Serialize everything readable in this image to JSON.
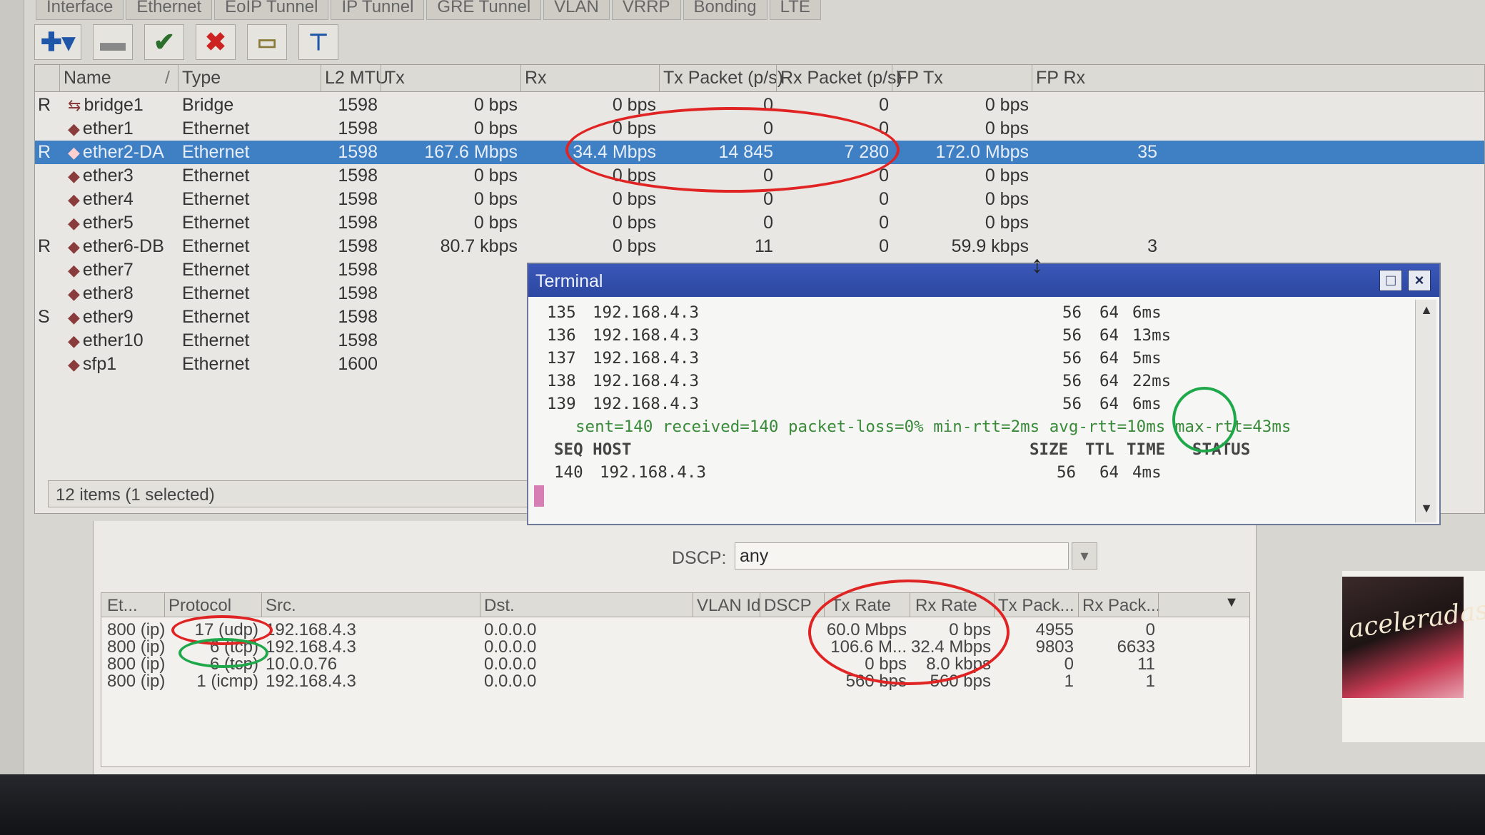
{
  "tabs": [
    "Interface",
    "Ethernet",
    "EoIP Tunnel",
    "IP Tunnel",
    "GRE Tunnel",
    "VLAN",
    "VRRP",
    "Bonding",
    "LTE"
  ],
  "toolbar": {
    "add": "✚▾",
    "remove": "▬",
    "enable": "✔",
    "disable": "✖",
    "comment": "▭",
    "filter": "⊤"
  },
  "interfaces": {
    "columns": [
      "Name",
      "Type",
      "L2 MTU",
      "Tx",
      "Rx",
      "Tx Packet (p/s)",
      "Rx Packet (p/s)",
      "FP Tx",
      "FP Rx"
    ],
    "rows": [
      {
        "flag": "R",
        "icon": "⇆",
        "name": "bridge1",
        "type": "Bridge",
        "mtu": "1598",
        "tx": "0 bps",
        "rx": "0 bps",
        "txp": "0",
        "rxp": "0",
        "fptx": "0 bps",
        "fprx": ""
      },
      {
        "flag": "",
        "icon": "◆",
        "name": "ether1",
        "type": "Ethernet",
        "mtu": "1598",
        "tx": "0 bps",
        "rx": "0 bps",
        "txp": "0",
        "rxp": "0",
        "fptx": "0 bps",
        "fprx": ""
      },
      {
        "flag": "R",
        "icon": "◆",
        "name": "ether2-DA",
        "type": "Ethernet",
        "mtu": "1598",
        "tx": "167.6 Mbps",
        "rx": "34.4 Mbps",
        "txp": "14 845",
        "rxp": "7 280",
        "fptx": "172.0 Mbps",
        "fprx": "35"
      },
      {
        "flag": "",
        "icon": "◆",
        "name": "ether3",
        "type": "Ethernet",
        "mtu": "1598",
        "tx": "0 bps",
        "rx": "0 bps",
        "txp": "0",
        "rxp": "0",
        "fptx": "0 bps",
        "fprx": ""
      },
      {
        "flag": "",
        "icon": "◆",
        "name": "ether4",
        "type": "Ethernet",
        "mtu": "1598",
        "tx": "0 bps",
        "rx": "0 bps",
        "txp": "0",
        "rxp": "0",
        "fptx": "0 bps",
        "fprx": ""
      },
      {
        "flag": "",
        "icon": "◆",
        "name": "ether5",
        "type": "Ethernet",
        "mtu": "1598",
        "tx": "0 bps",
        "rx": "0 bps",
        "txp": "0",
        "rxp": "0",
        "fptx": "0 bps",
        "fprx": ""
      },
      {
        "flag": "R",
        "icon": "◆",
        "name": "ether6-DB",
        "type": "Ethernet",
        "mtu": "1598",
        "tx": "80.7 kbps",
        "rx": "0 bps",
        "txp": "11",
        "rxp": "0",
        "fptx": "59.9 kbps",
        "fprx": "3"
      },
      {
        "flag": "",
        "icon": "◆",
        "name": "ether7",
        "type": "Ethernet",
        "mtu": "1598",
        "tx": "",
        "rx": "",
        "txp": "",
        "rxp": "",
        "fptx": "",
        "fprx": ""
      },
      {
        "flag": "",
        "icon": "◆",
        "name": "ether8",
        "type": "Ethernet",
        "mtu": "1598",
        "tx": "",
        "rx": "",
        "txp": "",
        "rxp": "",
        "fptx": "",
        "fprx": ""
      },
      {
        "flag": "S",
        "icon": "◆",
        "name": "ether9",
        "type": "Ethernet",
        "mtu": "1598",
        "tx": "",
        "rx": "",
        "txp": "",
        "rxp": "",
        "fptx": "",
        "fprx": ""
      },
      {
        "flag": "",
        "icon": "◆",
        "name": "ether10",
        "type": "Ethernet",
        "mtu": "1598",
        "tx": "",
        "rx": "",
        "txp": "",
        "rxp": "",
        "fptx": "",
        "fprx": ""
      },
      {
        "flag": "",
        "icon": "◆",
        "name": "sfp1",
        "type": "Ethernet",
        "mtu": "1600",
        "tx": "",
        "rx": "",
        "txp": "",
        "rxp": "",
        "fptx": "",
        "fprx": ""
      }
    ],
    "footer": "12 items (1 selected)"
  },
  "terminal": {
    "title": "Terminal",
    "lines": [
      {
        "seq": "135",
        "host": "192.168.4.3",
        "size": "56",
        "ttl": "64",
        "time": "6ms"
      },
      {
        "seq": "136",
        "host": "192.168.4.3",
        "size": "56",
        "ttl": "64",
        "time": "13ms"
      },
      {
        "seq": "137",
        "host": "192.168.4.3",
        "size": "56",
        "ttl": "64",
        "time": "5ms"
      },
      {
        "seq": "138",
        "host": "192.168.4.3",
        "size": "56",
        "ttl": "64",
        "time": "22ms"
      },
      {
        "seq": "139",
        "host": "192.168.4.3",
        "size": "56",
        "ttl": "64",
        "time": "6ms"
      }
    ],
    "summary": "sent=140 received=140 packet-loss=0% min-rtt=2ms avg-rtt=10ms max-rtt=43ms",
    "header": {
      "seq": "SEQ HOST",
      "size": "SIZE",
      "ttl": "TTL",
      "time": "TIME",
      "status": "STATUS"
    },
    "last": {
      "seq": "140",
      "host": "192.168.4.3",
      "size": "56",
      "ttl": "64",
      "time": "4ms"
    }
  },
  "filter": {
    "dscp_label": "DSCP:",
    "dscp_value": "any"
  },
  "flows": {
    "columns": [
      "Et...",
      "Protocol",
      "Src.",
      "Dst.",
      "VLAN Id",
      "DSCP",
      "Tx Rate",
      "Rx Rate",
      "Tx Pack...",
      "Rx Pack..."
    ],
    "rows": [
      {
        "et": "800 (ip)",
        "proto": "17 (udp)",
        "src": "192.168.4.3",
        "dst": "0.0.0.0",
        "txrate": "60.0 Mbps",
        "rxrate": "0 bps",
        "txp": "4955",
        "rxp": "0"
      },
      {
        "et": "800 (ip)",
        "proto": "6 (tcp)",
        "src": "192.168.4.3",
        "dst": "0.0.0.0",
        "txrate": "106.6 M...",
        "rxrate": "32.4 Mbps",
        "txp": "9803",
        "rxp": "6633"
      },
      {
        "et": "800 (ip)",
        "proto": "6 (tcp)",
        "src": "10.0.0.76",
        "dst": "0.0.0.0",
        "txrate": "0 bps",
        "rxrate": "8.0 kbps",
        "txp": "0",
        "rxp": "11"
      },
      {
        "et": "800 (ip)",
        "proto": "1 (icmp)",
        "src": "192.168.4.3",
        "dst": "0.0.0.0",
        "txrate": "560 bps",
        "rxrate": "560 bps",
        "txp": "1",
        "rxp": "1"
      }
    ]
  },
  "album": {
    "text": "aceleradas"
  },
  "colors": {
    "selection": "#3f7fc3",
    "annotation_red": "#e02424",
    "annotation_green": "#1fa84a",
    "title_bar": "#2c47a1"
  }
}
